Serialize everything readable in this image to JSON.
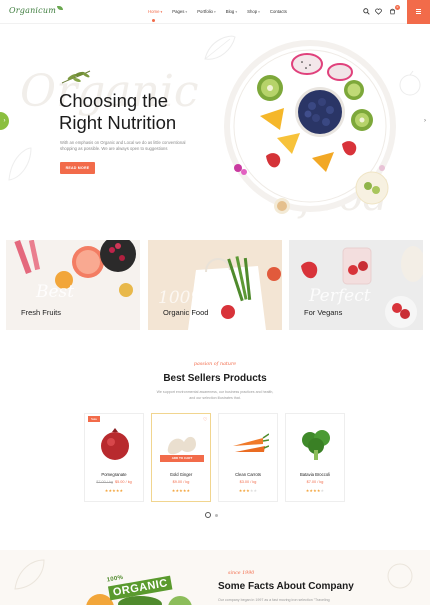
{
  "brand": {
    "logo_text": "Organicum",
    "accent": "#f26b4a",
    "green": "#8bbf3f"
  },
  "nav": {
    "items": [
      {
        "label": "Home",
        "active": true
      },
      {
        "label": "Pages",
        "active": false
      },
      {
        "label": "Portfolio",
        "active": false
      },
      {
        "label": "Blog",
        "active": false
      },
      {
        "label": "Shop",
        "active": false
      },
      {
        "label": "Contacts",
        "active": false
      }
    ],
    "cart_count": "0",
    "icons": [
      "search-icon",
      "heart-icon",
      "cart-icon",
      "menu-icon"
    ]
  },
  "hero": {
    "watermark_1": "Organic",
    "watermark_2": "food",
    "title_line1": "Choosing the",
    "title_line2": "Right Nutrition",
    "description": "With an emphasis on Organic and Local we do as little conventional shopping as possible. We are always open to suggestions",
    "button_label": "READ MORE"
  },
  "categories": [
    {
      "label": "Fresh Fruits",
      "script": "Best"
    },
    {
      "label": "Organic Food",
      "script": "100%"
    },
    {
      "label": "For Vegans",
      "script": "Perfect"
    }
  ],
  "best_sellers": {
    "script": "passion of nature",
    "title": "Best Sellers Products",
    "description": "We support environmental awareness, our business practices and health, and our selection illustrates that.",
    "add_to_cart_label": "ADD TO CART",
    "sale_label": "Sale",
    "products": [
      {
        "name": "Pomegranate",
        "old_price": "$7.00 / kg",
        "price": "$5.00 / kg",
        "stars": 5
      },
      {
        "name": "Gold Ginger",
        "old_price": "",
        "price": "$9.00 / kg",
        "stars": 5
      },
      {
        "name": "Clean Carrots",
        "old_price": "",
        "price": "$3.00 / kg",
        "stars": 3
      },
      {
        "name": "Batavia Broccoli",
        "old_price": "",
        "price": "$7.00 / kg",
        "stars": 4
      }
    ]
  },
  "facts": {
    "badge_top": "100%",
    "badge_main": "ORGANIC",
    "script": "since 1990",
    "title": "Some Facts About Company",
    "text": "Our company began in 1997 as a fast moving iron selection \"Traveling"
  }
}
